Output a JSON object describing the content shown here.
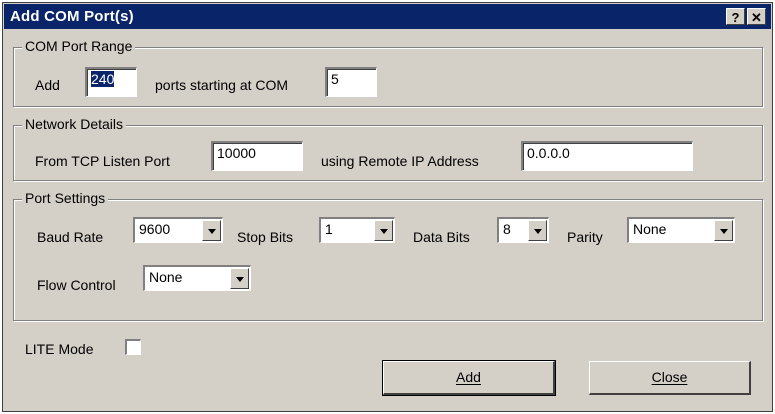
{
  "window": {
    "title": "Add COM Port(s)",
    "help_glyph": "?",
    "close_glyph": "✕"
  },
  "com_port_range": {
    "legend": "COM Port Range",
    "add_label": "Add",
    "ports_value": "240",
    "starting_label": "ports starting at COM",
    "start_value": "5"
  },
  "network_details": {
    "legend": "Network Details",
    "listen_label": "From TCP Listen Port",
    "listen_value": "10000",
    "remote_label": "using Remote IP Address",
    "remote_value": "0.0.0.0"
  },
  "port_settings": {
    "legend": "Port Settings",
    "baud_label": "Baud Rate",
    "baud_value": "9600",
    "stop_label": "Stop Bits",
    "stop_value": "1",
    "data_label": "Data Bits",
    "data_value": "8",
    "parity_label": "Parity",
    "parity_value": "None",
    "flow_label": "Flow Control",
    "flow_value": "None"
  },
  "lite_mode": {
    "label": "LITE Mode",
    "checked": false
  },
  "buttons": {
    "add": "Add",
    "close": "Close"
  }
}
